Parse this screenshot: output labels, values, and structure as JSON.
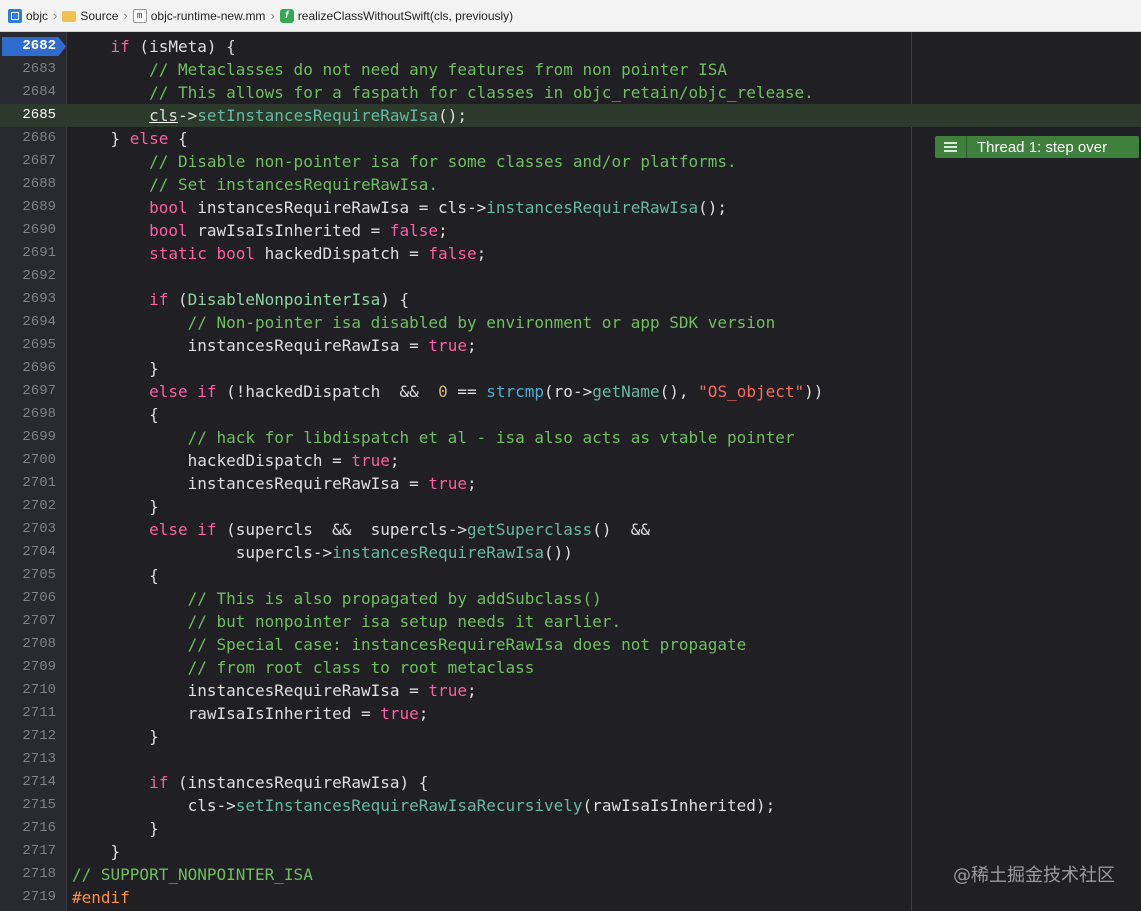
{
  "breadcrumb": {
    "project": "objc",
    "folder": "Source",
    "file": "objc-runtime-new.mm",
    "file_icon_letter": "m",
    "function_icon_letter": "f",
    "function": "realizeClassWithoutSwift(cls, previously)"
  },
  "editor": {
    "current_line": "2682",
    "thread_label": "Thread 1: step over",
    "line_numbers": [
      "2682",
      "2683",
      "2684",
      "2685",
      "2686",
      "2687",
      "2688",
      "2689",
      "2690",
      "2691",
      "2692",
      "2693",
      "2694",
      "2695",
      "2696",
      "2697",
      "2698",
      "2699",
      "2700",
      "2701",
      "2702",
      "2703",
      "2704",
      "2705",
      "2706",
      "2707",
      "2708",
      "2709",
      "2710",
      "2711",
      "2712",
      "2713",
      "2714",
      "2715",
      "2716",
      "2717",
      "2718",
      "2719"
    ],
    "lines": [
      [
        [
          "k",
          "    if"
        ],
        [
          "p",
          " (isMeta) {"
        ]
      ],
      [
        [
          "c",
          "        // Metaclasses do not need any features from non pointer ISA"
        ]
      ],
      [
        [
          "c",
          "        // This allows for a faspath for classes in objc_retain/objc_release."
        ]
      ],
      [
        [
          "p",
          "        "
        ],
        [
          "u",
          "cls"
        ],
        [
          "p",
          "->"
        ],
        [
          "f",
          "setInstancesRequireRawIsa"
        ],
        [
          "p",
          "();"
        ]
      ],
      [
        [
          "p",
          "    } "
        ],
        [
          "k",
          "else"
        ],
        [
          "p",
          " {"
        ]
      ],
      [
        [
          "c",
          "        // Disable non-pointer isa for some classes and/or platforms."
        ]
      ],
      [
        [
          "c",
          "        // Set instancesRequireRawIsa."
        ]
      ],
      [
        [
          "p",
          "        "
        ],
        [
          "k",
          "bool"
        ],
        [
          "p",
          " instancesRequireRawIsa = cls->"
        ],
        [
          "f",
          "instancesRequireRawIsa"
        ],
        [
          "p",
          "();"
        ]
      ],
      [
        [
          "p",
          "        "
        ],
        [
          "k",
          "bool"
        ],
        [
          "p",
          " rawIsaIsInherited = "
        ],
        [
          "k",
          "false"
        ],
        [
          "p",
          ";"
        ]
      ],
      [
        [
          "p",
          "        "
        ],
        [
          "k",
          "static"
        ],
        [
          "p",
          " "
        ],
        [
          "k",
          "bool"
        ],
        [
          "p",
          " hackedDispatch = "
        ],
        [
          "k",
          "false"
        ],
        [
          "p",
          ";"
        ]
      ],
      [
        [
          "p",
          ""
        ]
      ],
      [
        [
          "p",
          "        "
        ],
        [
          "k",
          "if"
        ],
        [
          "p",
          " ("
        ],
        [
          "m",
          "DisableNonpointerIsa"
        ],
        [
          "p",
          ") {"
        ]
      ],
      [
        [
          "c",
          "            // Non-pointer isa disabled by environment or app SDK version"
        ]
      ],
      [
        [
          "p",
          "            instancesRequireRawIsa = "
        ],
        [
          "k",
          "true"
        ],
        [
          "p",
          ";"
        ]
      ],
      [
        [
          "p",
          "        }"
        ]
      ],
      [
        [
          "p",
          "        "
        ],
        [
          "k",
          "else if"
        ],
        [
          "p",
          " (!hackedDispatch  &&  "
        ],
        [
          "n",
          "0"
        ],
        [
          "p",
          " == "
        ],
        [
          "b",
          "strcmp"
        ],
        [
          "p",
          "(ro->"
        ],
        [
          "f",
          "getName"
        ],
        [
          "p",
          "(), "
        ],
        [
          "s",
          "\"OS_object\""
        ],
        [
          "p",
          "))"
        ]
      ],
      [
        [
          "p",
          "        {"
        ]
      ],
      [
        [
          "c",
          "            // hack for libdispatch et al - isa also acts as vtable pointer"
        ]
      ],
      [
        [
          "p",
          "            hackedDispatch = "
        ],
        [
          "k",
          "true"
        ],
        [
          "p",
          ";"
        ]
      ],
      [
        [
          "p",
          "            instancesRequireRawIsa = "
        ],
        [
          "k",
          "true"
        ],
        [
          "p",
          ";"
        ]
      ],
      [
        [
          "p",
          "        }"
        ]
      ],
      [
        [
          "p",
          "        "
        ],
        [
          "k",
          "else if"
        ],
        [
          "p",
          " (supercls  &&  supercls->"
        ],
        [
          "f",
          "getSuperclass"
        ],
        [
          "p",
          "()  &&"
        ]
      ],
      [
        [
          "p",
          "                 supercls->"
        ],
        [
          "f",
          "instancesRequireRawIsa"
        ],
        [
          "p",
          "())"
        ]
      ],
      [
        [
          "p",
          "        {"
        ]
      ],
      [
        [
          "c",
          "            // This is also propagated by addSubclass()"
        ]
      ],
      [
        [
          "c",
          "            // but nonpointer isa setup needs it earlier."
        ]
      ],
      [
        [
          "c",
          "            // Special case: instancesRequireRawIsa does not propagate"
        ]
      ],
      [
        [
          "c",
          "            // from root class to root metaclass"
        ]
      ],
      [
        [
          "p",
          "            instancesRequireRawIsa = "
        ],
        [
          "k",
          "true"
        ],
        [
          "p",
          ";"
        ]
      ],
      [
        [
          "p",
          "            rawIsaIsInherited = "
        ],
        [
          "k",
          "true"
        ],
        [
          "p",
          ";"
        ]
      ],
      [
        [
          "p",
          "        }"
        ]
      ],
      [
        [
          "p",
          ""
        ]
      ],
      [
        [
          "p",
          "        "
        ],
        [
          "k",
          "if"
        ],
        [
          "p",
          " (instancesRequireRawIsa) {"
        ]
      ],
      [
        [
          "p",
          "            cls->"
        ],
        [
          "f",
          "setInstancesRequireRawIsaRecursively"
        ],
        [
          "p",
          "(rawIsaIsInherited);"
        ]
      ],
      [
        [
          "p",
          "        }"
        ]
      ],
      [
        [
          "p",
          "    }"
        ]
      ],
      [
        [
          "c",
          "// SUPPORT_NONPOINTER_ISA"
        ]
      ],
      [
        [
          "x",
          "#endif"
        ]
      ]
    ]
  },
  "watermark": "@稀土掘金技术社区",
  "colors": {
    "keyword": "#fc5fa3",
    "comment": "#6fbf5f",
    "function": "#67b7a4",
    "string": "#fc6a5d",
    "number": "#d0bf69",
    "preprocessor": "#fd8f3f",
    "highlight_line": "#2b3a2a",
    "pc_badge": "#2f6ccd",
    "thread_label": "#3d7f3b"
  }
}
